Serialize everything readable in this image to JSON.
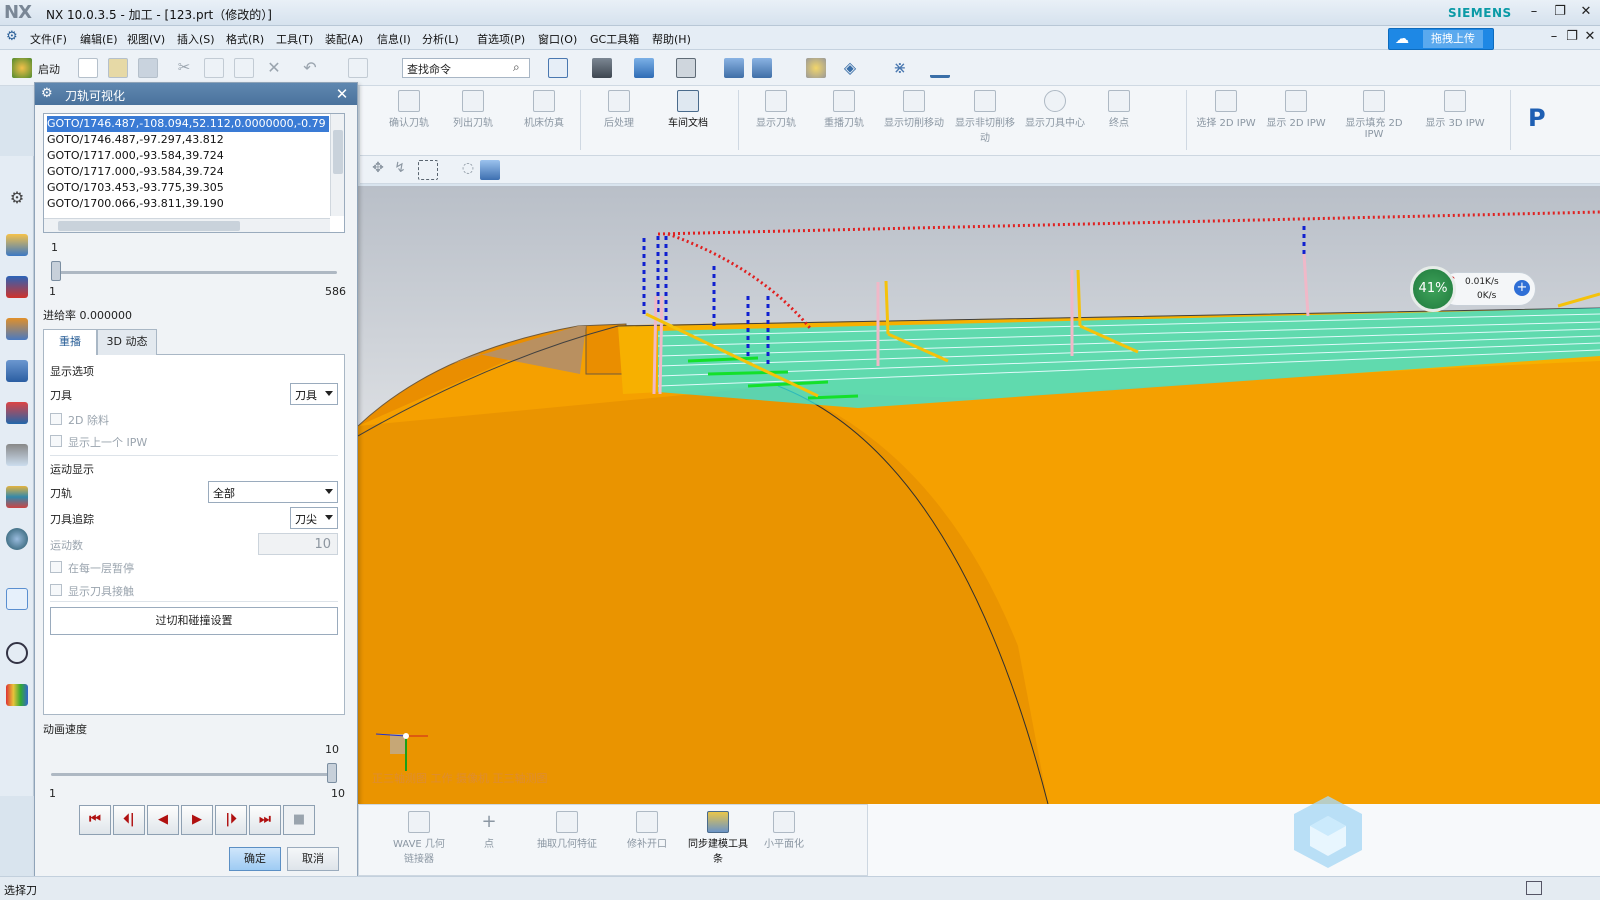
{
  "window": {
    "logo": "NX",
    "title": "NX 10.0.3.5 - 加工 - [123.prt（修改的）]",
    "brand": "SIEMENS"
  },
  "menu": {
    "items": [
      "文件(F)",
      "编辑(E)",
      "视图(V)",
      "插入(S)",
      "格式(R)",
      "工具(T)",
      "装配(A)",
      "信息(I)",
      "分析(L)",
      "首选项(P)",
      "窗口(O)",
      "GC工具箱",
      "帮助(H)"
    ],
    "upload_label": "拖拽上传"
  },
  "toolbar": {
    "start_label": "启动",
    "search_placeholder": "查找命令"
  },
  "ribbon": {
    "buttons": [
      "确认刀轨",
      "列出刀轨",
      "机床仿真",
      "后处理",
      "车间文档",
      "显示刀轨",
      "重播刀轨",
      "显示切削移动",
      "显示非切削移动",
      "显示刀具中心",
      "终点",
      "选择 2D IPW",
      "显示 2D IPW",
      "显示填充 2D IPW",
      "显示 3D IPW"
    ]
  },
  "bottom_ribbon": {
    "buttons": [
      "WAVE 几何链接器",
      "点",
      "抽取几何特征",
      "修补开口",
      "同步建模工具条",
      "小平面化"
    ]
  },
  "dialog": {
    "title": "刀轨可视化",
    "goto_list": [
      "GOTO/1746.487,-108.094,52.112,0.0000000,-0.79",
      "GOTO/1746.487,-97.297,43.812",
      "GOTO/1717.000,-93.584,39.724",
      "GOTO/1717.000,-93.584,39.724",
      "GOTO/1703.453,-93.775,39.305",
      "GOTO/1700.066,-93.811,39.190"
    ],
    "position_slider": {
      "current": "1",
      "min": "1",
      "max": "586",
      "value": 1
    },
    "feedrate_label": "进给率 0.000000",
    "tabs": [
      "重播",
      "3D 动态"
    ],
    "display_options": {
      "heading": "显示选项",
      "tool_label": "刀具",
      "tool_value": "刀具",
      "check_2d_remove": "2D 除料",
      "check_prev_ipw": "显示上一个 IPW"
    },
    "motion_display": {
      "heading": "运动显示",
      "toolpath_label": "刀轨",
      "toolpath_value": "全部",
      "trace_label": "刀具追踪",
      "trace_value": "刀尖",
      "motion_count_label": "运动数",
      "motion_count_value": "10",
      "check_pause_each_layer": "在每一层暂停",
      "check_show_contact": "显示刀具接触"
    },
    "gouge_button": "过切和碰撞设置",
    "speed": {
      "label": "动画速度",
      "current": "10",
      "min": "1",
      "max": "10",
      "value": 10
    },
    "ok_label": "确定",
    "cancel_label": "取消"
  },
  "viewport": {
    "view_label": "正三轴测图 工作 摄像机 正三轴测图"
  },
  "net_widget": {
    "percent": "41%",
    "up": "0.01K/s",
    "down": "0K/s"
  },
  "status": {
    "text": "选择刀"
  }
}
